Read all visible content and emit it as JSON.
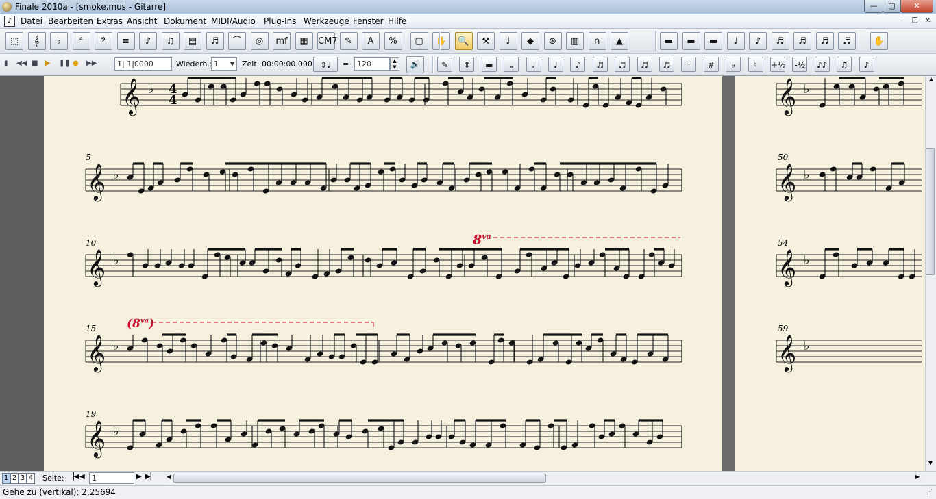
{
  "window": {
    "title": "Finale 2010a - [smoke.mus - Gitarre]",
    "minimize": "—",
    "maximize": "▢",
    "close": "✕"
  },
  "menu": {
    "items": [
      "Datei",
      "Bearbeiten",
      "Extras",
      "Ansicht",
      "Dokument",
      "MIDI/Audio",
      "Plug-Ins",
      "Werkzeuge",
      "Fenster",
      "Hilfe"
    ]
  },
  "toolbar1": {
    "tools": [
      "Auswahl",
      "Notenschlüssel",
      "Tonart",
      "Taktart",
      "Schlüssel",
      "Notenzeilen",
      "Einfache Eingabe",
      "Schnelle Eingabe",
      "HyperScribe",
      "Tuplet",
      "Bogen",
      "Artikulation",
      "Vortrag",
      "Akkord",
      "Lyrics",
      "Text",
      "Größe",
      "Seitenlayout",
      "Hand",
      "Zoom",
      "Hammer",
      "Speedy",
      "Spezial",
      "Wiederholung",
      "Mass-Edit",
      "Bezier",
      "Stimme"
    ],
    "tool_glyphs": [
      "⬚",
      "𝄞",
      "♭",
      "⁴",
      "𝄢",
      "≡",
      "♪",
      "♫",
      "▤",
      "♬",
      "⌒",
      "◎",
      "mf",
      "▦",
      "CM7",
      "✎",
      "A",
      "%",
      "▢",
      "✋",
      "🔍",
      "⚒",
      "♩",
      "◆",
      "⊛",
      "▥",
      "∩",
      "▲"
    ],
    "right_glyphs": [
      "▬",
      "▬",
      "▬",
      "♩",
      "♪",
      "♬",
      "♬",
      "♬",
      "♬",
      "✋"
    ]
  },
  "toolbar2": {
    "transport_glyphs": [
      "▮",
      "◀◀",
      "■",
      "▶",
      "❚❚",
      "●",
      "▶▶"
    ],
    "position_value": "1| 1|0000",
    "repeat_label": "Wiederh.:",
    "repeat_value": "1",
    "time_label": "Zeit:",
    "time_value": "00:00:00.000",
    "tempo_equals": "=",
    "tempo_value": "120",
    "entry_glyphs": [
      "✎",
      "⇕",
      "▬",
      "𝅝",
      "𝅗𝅥",
      "♩",
      "♪",
      "♬",
      "♬",
      "♬",
      "♬",
      "·",
      "#",
      "♭",
      "♮",
      "+½",
      "-½",
      "♪♪",
      "♫",
      "♪"
    ]
  },
  "score": {
    "left_measure_numbers": [
      "5",
      "10",
      "15",
      "19"
    ],
    "right_measure_numbers": [
      "50",
      "54",
      "59"
    ],
    "ottava_1": "8",
    "ottava_1_suffix": "va",
    "ottava_2": "8",
    "ottava_2_suffix": "va",
    "time_sig_top": "4",
    "time_sig_bottom": "4"
  },
  "pagebar": {
    "pages": [
      "1",
      "2",
      "3",
      "4"
    ],
    "label": "Seite:",
    "page_value": "1"
  },
  "status": {
    "text": "Gehe zu (vertikal): 2,25694"
  }
}
